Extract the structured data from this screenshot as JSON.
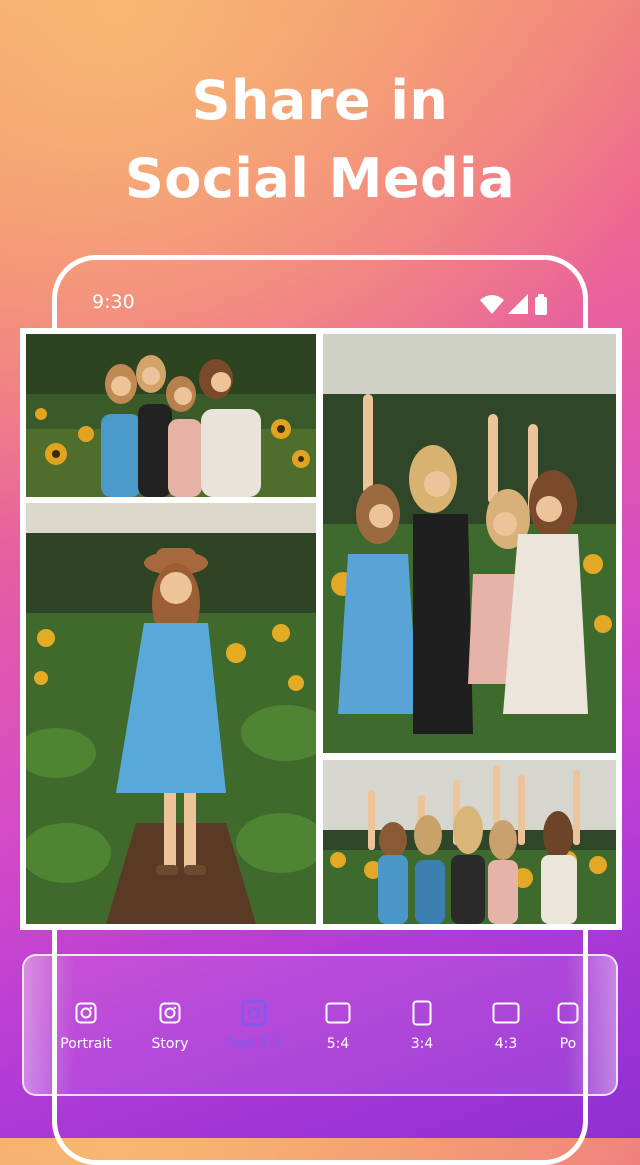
{
  "headline": {
    "line1": "Share in",
    "line2": "Social Media"
  },
  "status_bar": {
    "time": "9:30",
    "icons": [
      "wifi-icon",
      "signal-icon",
      "battery-icon"
    ]
  },
  "collage": {
    "photos": [
      "group-photo-sunflowers",
      "girl-in-hat-photo",
      "group-peace-sign-photo",
      "group-arms-raised-photo"
    ]
  },
  "toolbar": {
    "active": "Post 1:1",
    "items": [
      {
        "label": "Portrait",
        "icon": "instagram-icon"
      },
      {
        "label": "Story",
        "icon": "instagram-icon"
      },
      {
        "label": "Post 1:1",
        "icon": "instagram-icon"
      },
      {
        "label": "5:4",
        "icon": "ratio-landscape-icon"
      },
      {
        "label": "3:4",
        "icon": "ratio-portrait-icon"
      },
      {
        "label": "4:3",
        "icon": "ratio-landscape-icon"
      },
      {
        "label": "Po",
        "icon": "instagram-icon"
      }
    ]
  },
  "colors": {
    "active": "#7b5cf0",
    "gradient_start": "#f39a6a",
    "gradient_end": "#8e2fd0"
  }
}
